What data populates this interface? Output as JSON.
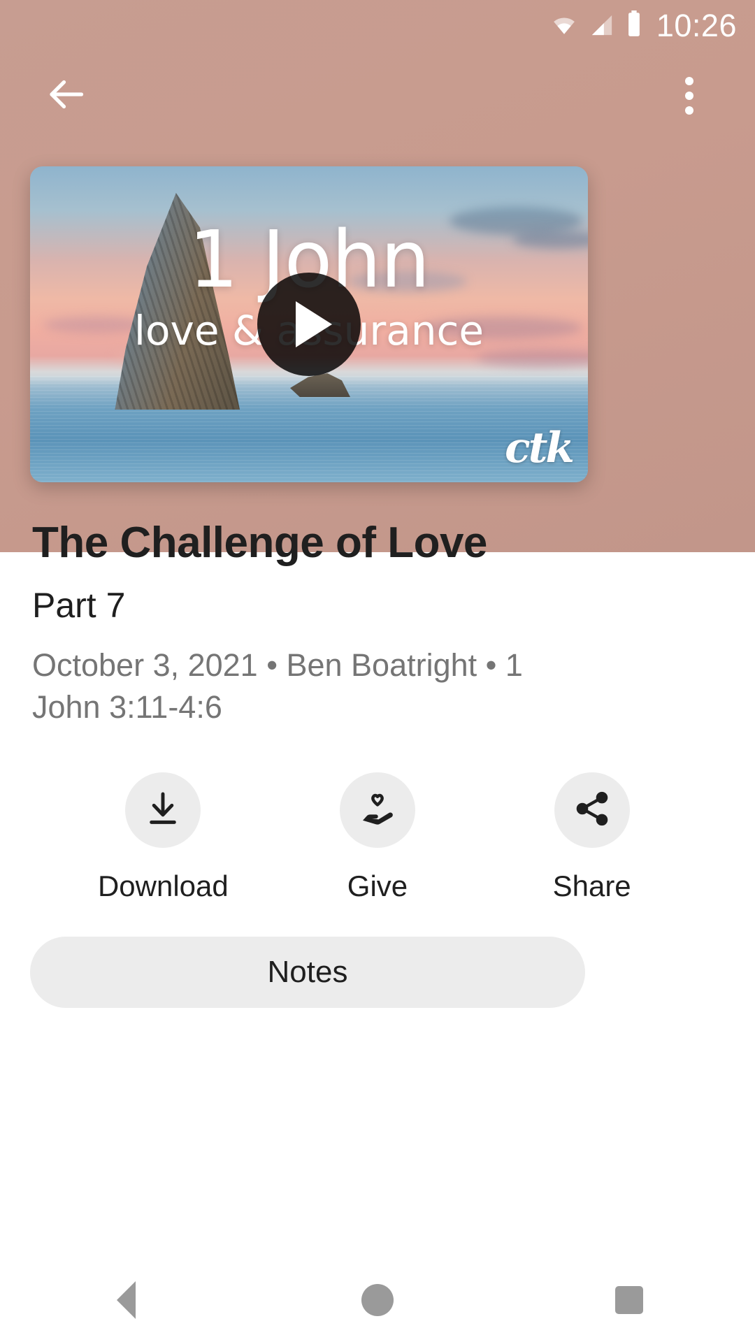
{
  "status_bar": {
    "time": "10:26",
    "icons": [
      "wifi-icon",
      "cellular-signal-icon",
      "battery-icon"
    ]
  },
  "app_bar": {
    "back_icon": "back-arrow-icon",
    "overflow_icon": "more-vertical-icon"
  },
  "video": {
    "series_title": "1 John",
    "series_subtitle": "love & assurance",
    "watermark": "ctk",
    "play_icon": "play-icon"
  },
  "sermon": {
    "title": "The Challenge of Love",
    "part": "Part 7",
    "meta": "October 3, 2021 • Ben Boatright • 1 John 3:11-4:6",
    "date": "October 3, 2021",
    "speaker": "Ben Boatright",
    "scripture": "1 John 3:11-4:6"
  },
  "actions": [
    {
      "label": "Download",
      "icon": "download-icon"
    },
    {
      "label": "Give",
      "icon": "hand-heart-icon"
    },
    {
      "label": "Share",
      "icon": "share-icon"
    }
  ],
  "notes": {
    "label": "Notes"
  },
  "nav_bar": {
    "back": "triangle-back-icon",
    "home": "circle-home-icon",
    "recents": "square-recents-icon"
  },
  "colors": {
    "header": "#c89b8e",
    "surface": "#ffffff",
    "chip": "#ececec",
    "text_primary": "#1f1f1f",
    "text_secondary": "#757575",
    "nav_icon": "#9a9a9a"
  }
}
